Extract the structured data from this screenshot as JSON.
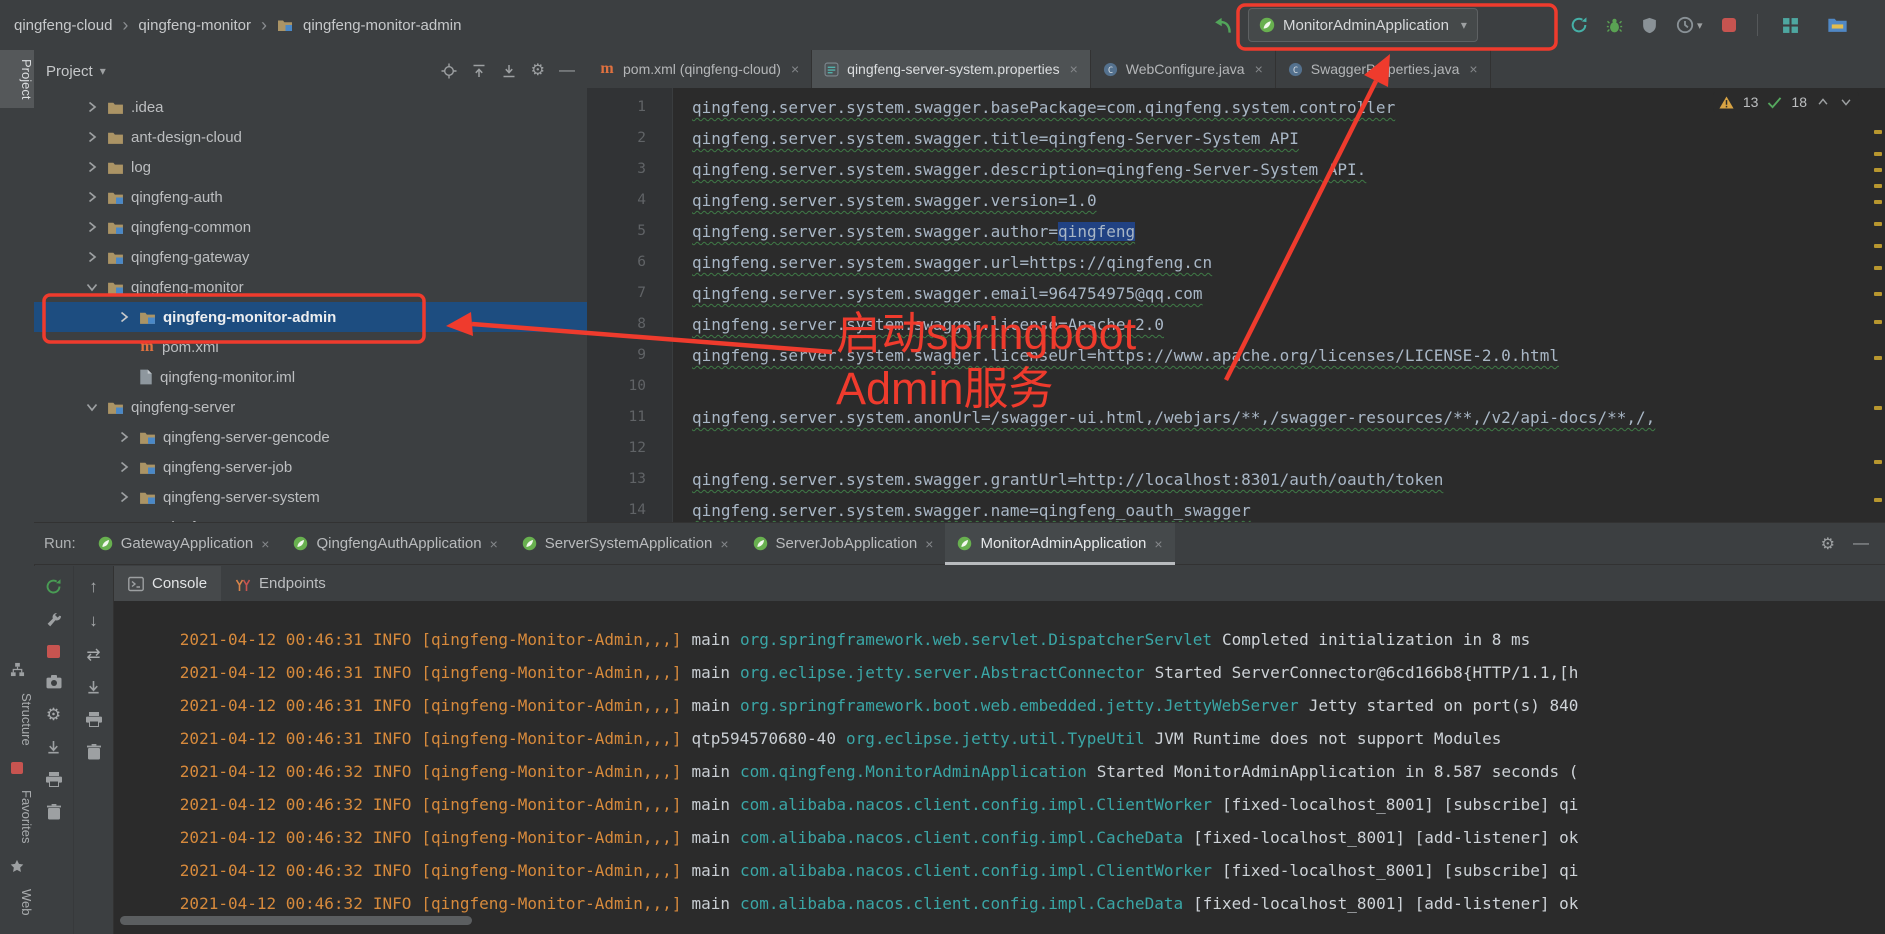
{
  "icons": {
    "chevron_down": "▾",
    "close": "×",
    "minus": "—",
    "gear": "⚙",
    "up": "↑",
    "down": "↓",
    "swap": "⇄",
    "crumb_sep": "›"
  },
  "title_bar": {
    "breadcrumbs": [
      "qingfeng-cloud",
      "qingfeng-monitor",
      "qingfeng-monitor-admin"
    ],
    "run_config": "MonitorAdminApplication"
  },
  "left_stripe": {
    "project_tab": "Project",
    "structure_tab": "Structure",
    "favorites_tab": "Favorites",
    "web_tab": "Web"
  },
  "project_panel": {
    "title": "Project",
    "tree": [
      {
        "label": ".idea"
      },
      {
        "label": "ant-design-cloud"
      },
      {
        "label": "log"
      },
      {
        "label": "qingfeng-auth"
      },
      {
        "label": "qingfeng-common"
      },
      {
        "label": "qingfeng-gateway"
      },
      {
        "label": "qingfeng-monitor"
      },
      {
        "label": "qingfeng-monitor-admin"
      },
      {
        "label": "pom.xml"
      },
      {
        "label": "qingfeng-monitor.iml"
      },
      {
        "label": "qingfeng-server"
      },
      {
        "label": "qingfeng-server-gencode"
      },
      {
        "label": "qingfeng-server-job"
      },
      {
        "label": "qingfeng-server-system"
      },
      {
        "label": "qingfeng-server-test"
      }
    ]
  },
  "editor": {
    "tabs": [
      {
        "label": "pom.xml (qingfeng-cloud)"
      },
      {
        "label": "qingfeng-server-system.properties"
      },
      {
        "label": "WebConfigure.java"
      },
      {
        "label": "SwaggerProperties.java"
      }
    ],
    "inspections": {
      "warnings": "13",
      "typos": "18"
    },
    "lines": [
      {
        "n": "1",
        "text": "qingfeng.server.system.swagger.basePackage=com.qingfeng.system.controller"
      },
      {
        "n": "2",
        "text": "qingfeng.server.system.swagger.title=qingfeng-Server-System API"
      },
      {
        "n": "3",
        "text": "qingfeng.server.system.swagger.description=qingfeng-Server-System API."
      },
      {
        "n": "4",
        "text": "qingfeng.server.system.swagger.version=1.0"
      },
      {
        "n": "5",
        "prefix": "qingfeng.server.system.swagger.author=",
        "selected": "qingfeng"
      },
      {
        "n": "6",
        "text": "qingfeng.server.system.swagger.url=https://qingfeng.cn"
      },
      {
        "n": "7",
        "text": "qingfeng.server.system.swagger.email=964754975@qq.com"
      },
      {
        "n": "8",
        "text": "qingfeng.server.system.swagger.license=Apache 2.0"
      },
      {
        "n": "9",
        "text": "qingfeng.server.system.swagger.licenseUrl=https://www.apache.org/licenses/LICENSE-2.0.html"
      },
      {
        "n": "10",
        "text": ""
      },
      {
        "n": "11",
        "text": "qingfeng.server.system.anonUrl=/swagger-ui.html,/webjars/**,/swagger-resources/**,/v2/api-docs/**,/,"
      },
      {
        "n": "12",
        "text": ""
      },
      {
        "n": "13",
        "text": "qingfeng.server.system.swagger.grantUrl=http://localhost:8301/auth/oauth/token"
      },
      {
        "n": "14",
        "text": "qingfeng.server.system.swagger.name=qingfeng_oauth_swagger"
      }
    ]
  },
  "run_panel": {
    "label": "Run:",
    "tabs": [
      {
        "label": "GatewayApplication"
      },
      {
        "label": "QingfengAuthApplication"
      },
      {
        "label": "ServerSystemApplication"
      },
      {
        "label": "ServerJobApplication"
      },
      {
        "label": "MonitorAdminApplication"
      }
    ],
    "views": [
      {
        "label": "Console"
      },
      {
        "label": "Endpoints"
      }
    ],
    "logs": [
      {
        "t": "2021-04-12 00:46:31",
        "lvl": "INFO",
        "ctx": "[qingfeng-Monitor-Admin,,,]",
        "thread": "main",
        "logger": "org.springframework.web.servlet.DispatcherServlet",
        "msg": "Completed initialization in 8 ms"
      },
      {
        "t": "2021-04-12 00:46:31",
        "lvl": "INFO",
        "ctx": "[qingfeng-Monitor-Admin,,,]",
        "thread": "main",
        "logger": "org.eclipse.jetty.server.AbstractConnector",
        "msg": "Started ServerConnector@6cd166b8{HTTP/1.1,[h"
      },
      {
        "t": "2021-04-12 00:46:31",
        "lvl": "INFO",
        "ctx": "[qingfeng-Monitor-Admin,,,]",
        "thread": "main",
        "logger": "org.springframework.boot.web.embedded.jetty.JettyWebServer",
        "msg": "Jetty started on port(s) 840"
      },
      {
        "t": "2021-04-12 00:46:31",
        "lvl": "INFO",
        "ctx": "[qingfeng-Monitor-Admin,,,]",
        "thread": "qtp594570680-40",
        "logger": "org.eclipse.jetty.util.TypeUtil",
        "msg": "JVM Runtime does not support Modules"
      },
      {
        "t": "2021-04-12 00:46:32",
        "lvl": "INFO",
        "ctx": "[qingfeng-Monitor-Admin,,,]",
        "thread": "main",
        "logger": "com.qingfeng.MonitorAdminApplication",
        "msg": "Started MonitorAdminApplication in 8.587 seconds ("
      },
      {
        "t": "2021-04-12 00:46:32",
        "lvl": "INFO",
        "ctx": "[qingfeng-Monitor-Admin,,,]",
        "thread": "main",
        "logger": "com.alibaba.nacos.client.config.impl.ClientWorker",
        "msg": "[fixed-localhost_8001] [subscribe] qi"
      },
      {
        "t": "2021-04-12 00:46:32",
        "lvl": "INFO",
        "ctx": "[qingfeng-Monitor-Admin,,,]",
        "thread": "main",
        "logger": "com.alibaba.nacos.client.config.impl.CacheData",
        "msg": "[fixed-localhost_8001] [add-listener] ok"
      },
      {
        "t": "2021-04-12 00:46:32",
        "lvl": "INFO",
        "ctx": "[qingfeng-Monitor-Admin,,,]",
        "thread": "main",
        "logger": "com.alibaba.nacos.client.config.impl.ClientWorker",
        "msg": "[fixed-localhost_8001] [subscribe] qi"
      },
      {
        "t": "2021-04-12 00:46:32",
        "lvl": "INFO",
        "ctx": "[qingfeng-Monitor-Admin,,,]",
        "thread": "main",
        "logger": "com.alibaba.nacos.client.config.impl.CacheData",
        "msg": "[fixed-localhost_8001] [add-listener] ok"
      }
    ]
  },
  "annotation": {
    "line1": "启动springboot",
    "line2": "Admin服务"
  },
  "colors": {
    "accent_red": "#ef3b2d",
    "spring_green": "#68b04f",
    "selection_blue": "#214283",
    "tree_selection": "#1d4d80"
  }
}
